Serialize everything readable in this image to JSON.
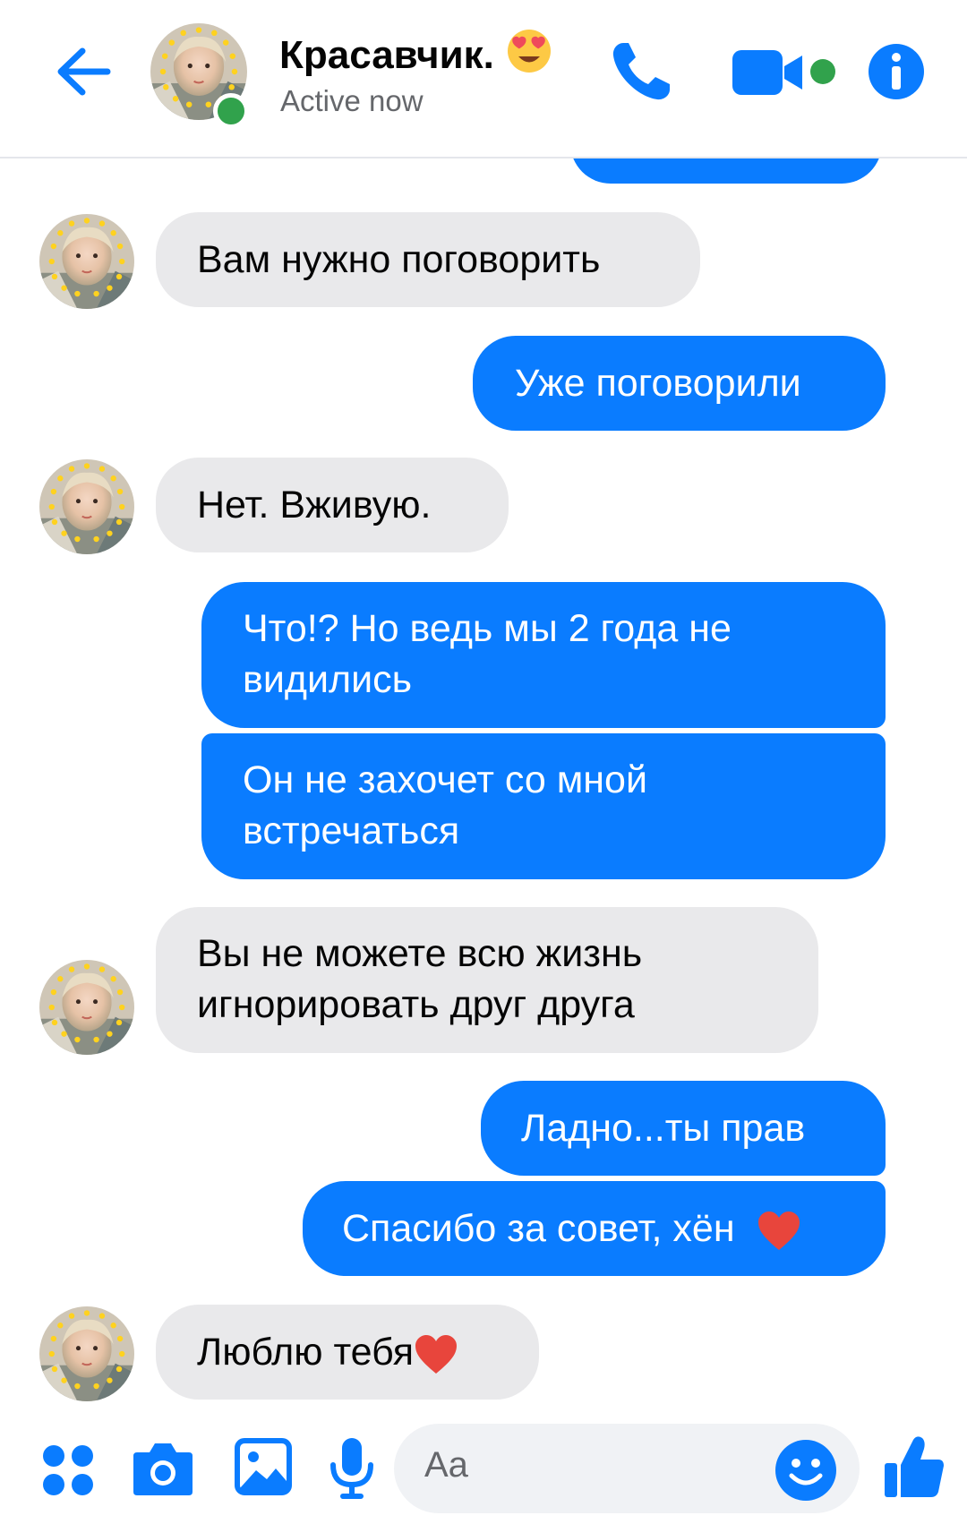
{
  "header": {
    "contact_name": "Красавчик.",
    "status": "Active now",
    "icons": [
      "back-arrow-icon",
      "avatar",
      "phone-icon",
      "video-camera-icon",
      "info-icon"
    ]
  },
  "messages": [
    {
      "side": "in",
      "text": "Вам нужно поговорить"
    },
    {
      "side": "out",
      "text": "Уже поговорили"
    },
    {
      "side": "in",
      "text": "Нет. Вживую."
    },
    {
      "side": "out",
      "text": "Что!? Но ведь мы 2 года не видились"
    },
    {
      "side": "out",
      "text": "Он не захочет со мной встречаться"
    },
    {
      "side": "in",
      "text": "Вы не можете всю жизнь игнорировать друг друга"
    },
    {
      "side": "out",
      "text": "Ладно...ты прав"
    },
    {
      "side": "out",
      "text": "Спасибо за совет, хён"
    },
    {
      "side": "in",
      "text": "Люблю тебя"
    }
  ],
  "composer": {
    "placeholder": "Aa",
    "icons": [
      "apps-grid-icon",
      "camera-icon",
      "gallery-icon",
      "microphone-icon",
      "emoji-icon",
      "like-thumb-icon"
    ]
  },
  "colors": {
    "accent": "#0a7cff",
    "incoming": "#e9e9eb",
    "online": "#31a24c",
    "heart": "#e8453c"
  }
}
